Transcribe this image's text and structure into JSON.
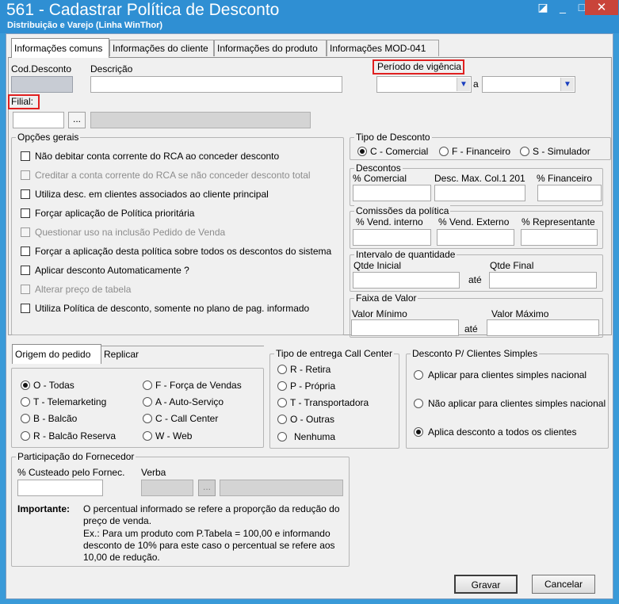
{
  "window": {
    "title": "561 - Cadastrar Política de Desconto",
    "subtitle": "Distribuição e Varejo (Linha WinThor)",
    "controls": {
      "restore": "◪",
      "minimize": "_",
      "maximize": "□",
      "close": "✕"
    }
  },
  "tabs": [
    "Informações comuns",
    "Informações do cliente",
    "Informações do produto",
    "Informações MOD-041"
  ],
  "header": {
    "cod_label": "Cod.Desconto",
    "descricao_label": "Descrição",
    "periodo_label": "Período de vigência",
    "a_label": "a",
    "filial_label": "Filial:",
    "ellipsis": "..."
  },
  "opcoes_gerais": {
    "title": "Opções gerais",
    "items": [
      {
        "label": "Não debitar conta corrente do RCA ao conceder desconto",
        "enabled": true
      },
      {
        "label": "Creditar a conta corrente do RCA se não conceder desconto total",
        "enabled": false
      },
      {
        "label": "Utiliza desc. em clientes associados ao cliente principal",
        "enabled": true
      },
      {
        "label": "Forçar aplicação de Política prioritária",
        "enabled": true
      },
      {
        "label": "Questionar uso na inclusão Pedido de Venda",
        "enabled": false
      },
      {
        "label": "Forçar a aplicação desta política sobre todos os descontos do sistema",
        "enabled": true
      },
      {
        "label": "Aplicar desconto Automaticamente ?",
        "enabled": true
      },
      {
        "label": "Alterar preço de tabela",
        "enabled": false
      },
      {
        "label": "Utiliza Política de desconto, somente no plano de pag. informado",
        "enabled": true
      }
    ]
  },
  "tipo_desconto": {
    "title": "Tipo de Desconto",
    "options": [
      "C - Comercial",
      "F - Financeiro",
      "S - Simulador"
    ],
    "selected": "C - Comercial"
  },
  "descontos": {
    "title": "Descontos",
    "fields": [
      "% Comercial",
      "Desc. Max. Col.1 201",
      "% Financeiro"
    ]
  },
  "comissoes": {
    "title": "Comissões da política",
    "fields": [
      "% Vend. interno",
      "% Vend. Externo",
      "% Representante"
    ]
  },
  "intervalo": {
    "title": "Intervalo de quantidade",
    "inicial": "Qtde Inicial",
    "final": "Qtde Final",
    "ate": "até"
  },
  "faixa": {
    "title": "Faixa de Valor",
    "minimo": "Valor Mínimo",
    "maximo": "Valor Máximo",
    "ate": "até"
  },
  "origem_tabs": [
    "Origem do pedido",
    "Replicar"
  ],
  "origem": {
    "options": [
      "O - Todas",
      "T - Telemarketing",
      "B - Balcão",
      "R - Balcão Reserva",
      "F - Força de Vendas",
      "A - Auto-Serviço",
      "C - Call Center",
      "W - Web"
    ],
    "selected": "O - Todas"
  },
  "entrega": {
    "title": "Tipo de entrega Call Center",
    "options": [
      "R - Retira",
      "P - Própria",
      "T - Transportadora",
      "O - Outras",
      "Nenhuma"
    ]
  },
  "simples": {
    "title": "Desconto P/ Clientes Simples",
    "options": [
      "Aplicar para clientes simples nacional",
      "Não aplicar para clientes simples nacional",
      "Aplica desconto a todos os clientes"
    ],
    "selected": "Aplica desconto a todos os clientes"
  },
  "fornecedor": {
    "title": "Participação do Fornecedor",
    "custeado_label": "% Custeado pelo Fornec.",
    "verba_label": "Verba",
    "importante_label": "Importante:",
    "importante_text": "O percentual informado se refere a proporção da redução do preço de venda.",
    "exemplo_text": "Ex.: Para um produto com P.Tabela = 100,00 e informando desconto de 10% para este caso o percentual se refere aos 10,00 de redução."
  },
  "buttons": {
    "gravar": "Gravar",
    "cancelar": "Cancelar"
  }
}
